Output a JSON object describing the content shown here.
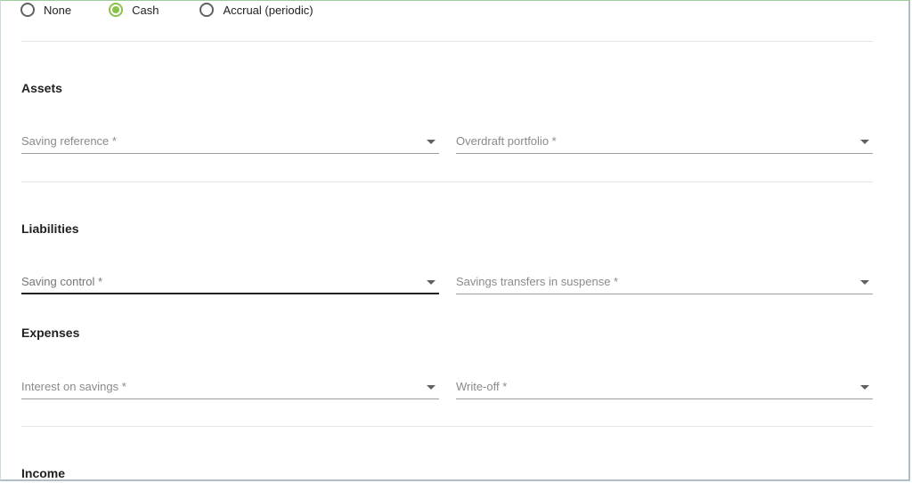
{
  "accounting_options": [
    {
      "label": "None",
      "checked": false
    },
    {
      "label": "Cash",
      "checked": true
    },
    {
      "label": "Accrual (periodic)",
      "checked": false
    }
  ],
  "sections": {
    "assets": {
      "title": "Assets",
      "fields": [
        "Saving reference *",
        "Overdraft portfolio *"
      ]
    },
    "liabilities": {
      "title": "Liabilities",
      "fields": [
        "Saving control *",
        "Savings transfers in suspense *"
      ]
    },
    "expenses": {
      "title": "Expenses",
      "fields": [
        "Interest on savings *",
        "Write-off *"
      ]
    },
    "income": {
      "title": "Income"
    }
  },
  "colors": {
    "accent": "#8bc34a",
    "text": "#212121",
    "placeholder": "#8a8a8a",
    "divider": "#e6e6e6"
  }
}
